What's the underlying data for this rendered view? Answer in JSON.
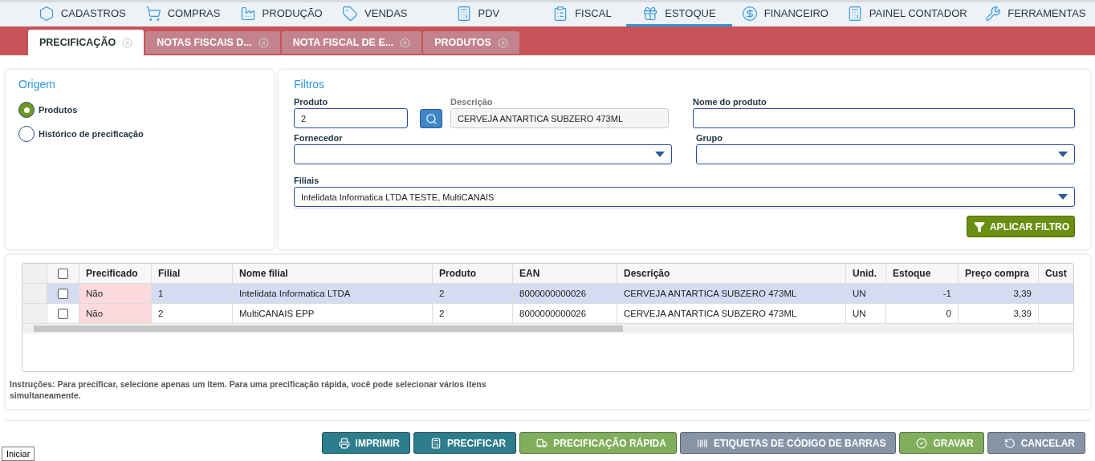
{
  "nav": [
    {
      "label": "CADASTROS",
      "selected": false
    },
    {
      "label": "COMPRAS",
      "selected": false
    },
    {
      "label": "PRODUÇÃO",
      "selected": false
    },
    {
      "label": "VENDAS",
      "selected": false
    },
    {
      "label": "PDV",
      "selected": false
    },
    {
      "label": "FISCAL",
      "selected": false
    },
    {
      "label": "ESTOQUE",
      "selected": true
    },
    {
      "label": "FINANCEIRO",
      "selected": false
    },
    {
      "label": "PAINEL CONTADOR",
      "selected": false
    },
    {
      "label": "FERRAMENTAS",
      "selected": false
    }
  ],
  "tabs": [
    {
      "label": "PRECIFICAÇÃO",
      "selected": true
    },
    {
      "label": "NOTAS FISCAIS D...",
      "selected": false
    },
    {
      "label": "NOTA FISCAL DE E...",
      "selected": false
    },
    {
      "label": "PRODUTOS",
      "selected": false
    }
  ],
  "origem": {
    "title": "Origem",
    "options": [
      {
        "label": "Produtos",
        "selected": true
      },
      {
        "label": "Histórico de precificação",
        "selected": false
      }
    ]
  },
  "filtros": {
    "title": "Filtros",
    "produto": {
      "label": "Produto",
      "value": "2"
    },
    "descricao": {
      "label": "Descrição",
      "value": "CERVEJA ANTARTICA SUBZERO 473ML"
    },
    "nome_produto": {
      "label": "Nome do produto"
    },
    "fornecedor": {
      "label": "Fornecedor"
    },
    "grupo": {
      "label": "Grupo"
    },
    "filiais": {
      "label": "Filiais",
      "value": "Intelidata Informatica LTDA TESTE, MultiCANAIS"
    },
    "apply_button": "APLICAR FILTRO"
  },
  "table": {
    "select_all": {
      "checked": false
    },
    "columns": [
      "Precificado",
      "Filial",
      "Nome filial",
      "Produto",
      "EAN",
      "Descrição",
      "Unid.",
      "Estoque",
      "Preço compra",
      "Cust"
    ],
    "rows": [
      {
        "selected": true,
        "checked": false,
        "cells": [
          "Não",
          "1",
          "Intelidata Informatica LTDA",
          "2",
          "8000000000026",
          "CERVEJA ANTARTICA SUBZERO 473ML",
          "UN",
          "-1",
          "3,39"
        ]
      },
      {
        "selected": false,
        "checked": false,
        "cells": [
          "Não",
          "2",
          "MultiCANAIS EPP",
          "2",
          "8000000000026",
          "CERVEJA ANTARTICA SUBZERO 473ML",
          "UN",
          "0",
          "3,39"
        ]
      }
    ]
  },
  "instructions": "Instruções: Para precificar, selecione apenas um item. Para uma precificação rápida, você pode selecionar vários itens simultaneamente.",
  "buttons": [
    {
      "label": "IMPRIMIR",
      "color": "#2d7d8c"
    },
    {
      "label": "PRECIFICAR",
      "color": "#2d7d8c"
    },
    {
      "label": "PRECIFICAÇÃO RÁPIDA",
      "color": "#80ae5c"
    },
    {
      "label": "ETIQUETAS DE CÓDIGO DE BARRAS",
      "color": "#8794a6"
    },
    {
      "label": "GRAVAR",
      "color": "#80ae5c"
    },
    {
      "label": "CANCELAR",
      "color": "#8794a6"
    }
  ],
  "tooltip": "Iniciar"
}
